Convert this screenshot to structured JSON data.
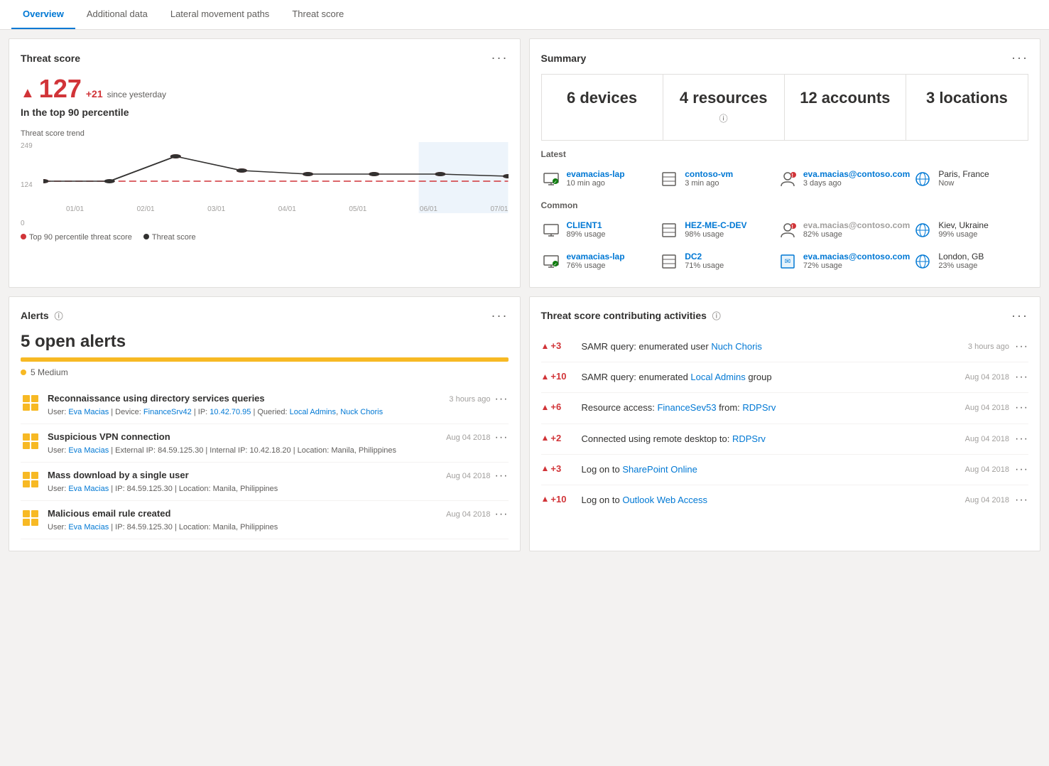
{
  "tabs": [
    {
      "label": "Overview",
      "active": true
    },
    {
      "label": "Additional data",
      "active": false
    },
    {
      "label": "Lateral movement paths",
      "active": false
    },
    {
      "label": "Threat score",
      "active": false
    }
  ],
  "threatScore": {
    "title": "Threat score",
    "score": "127",
    "delta": "+21",
    "delta_label": "since yesterday",
    "percentile_text": "In the top 90 percentile",
    "chart_label": "Threat score trend",
    "y_labels": [
      "249",
      "124",
      "0"
    ],
    "x_labels": [
      "01/01",
      "02/01",
      "03/01",
      "04/01",
      "05/01",
      "06/01",
      "07/01"
    ],
    "legend": [
      {
        "label": "Top 90 percentile threat score",
        "color": "#d13438"
      },
      {
        "label": "Threat score",
        "color": "#323130"
      }
    ]
  },
  "summary": {
    "title": "Summary",
    "stats": [
      {
        "value": "6 devices",
        "label": ""
      },
      {
        "value": "4 resources",
        "label": "",
        "has_info": true
      },
      {
        "value": "12 accounts",
        "label": ""
      },
      {
        "value": "3 locations",
        "label": ""
      }
    ],
    "latest_label": "Latest",
    "latest_items": [
      {
        "name": "evamacias-lap",
        "time": "10 min ago",
        "type": "device",
        "color": "blue"
      },
      {
        "name": "contoso-vm",
        "time": "3 min ago",
        "type": "server",
        "color": "blue"
      },
      {
        "name": "eva.macias@contoso.com",
        "time": "3 days ago",
        "type": "user",
        "color": "blue",
        "alert": true
      },
      {
        "name": "Paris, France",
        "time": "Now",
        "type": "globe",
        "color": "blue"
      }
    ],
    "common_label": "Common",
    "common_items": [
      {
        "name": "CLIENT1",
        "usage": "89% usage",
        "type": "device"
      },
      {
        "name": "HEZ-ME-C-DEV",
        "usage": "98% usage",
        "type": "server"
      },
      {
        "name": "eva.macias@contoso.com",
        "usage": "82% usage",
        "type": "user",
        "alert": true,
        "gray": true
      },
      {
        "name": "Kiev, Ukraine",
        "usage": "99% usage",
        "type": "globe"
      }
    ],
    "common2_items": [
      {
        "name": "evamacias-lap",
        "usage": "76% usage",
        "type": "device"
      },
      {
        "name": "DC2",
        "usage": "71% usage",
        "type": "server"
      },
      {
        "name": "eva.macias@contoso.com",
        "usage": "72% usage",
        "type": "user"
      },
      {
        "name": "London, GB",
        "usage": "23% usage",
        "type": "globe"
      }
    ]
  },
  "alerts": {
    "title": "Alerts",
    "count_text": "5 open alerts",
    "medium_text": "5 Medium",
    "items": [
      {
        "title": "Reconnaissance using directory services queries",
        "time": "3 hours ago",
        "detail": "User: Eva Macias | Device: FinanceSrv42 | IP: 10.42.70.95 | Queried: Local Admins, Nuck Choris"
      },
      {
        "title": "Suspicious VPN connection",
        "time": "Aug 04 2018",
        "detail": "User: Eva Macias | External IP: 84.59.125.30 | Internal IP: 10.42.18.20 | Location: Manila, Philippines"
      },
      {
        "title": "Mass download by a single user",
        "time": "Aug 04 2018",
        "detail": "User: Eva Macias | IP: 84.59.125.30 | Location: Manila, Philippines"
      },
      {
        "title": "Malicious email rule created",
        "time": "Aug 04 2018",
        "detail": "User: Eva Macias | IP: 84.59.125.30 | Location: Manila, Philippines"
      }
    ]
  },
  "threatActivities": {
    "title": "Threat score contributing activities",
    "items": [
      {
        "delta": "+3",
        "description": "SAMR query: enumerated user ",
        "link_text": "Nuch Choris",
        "suffix": "",
        "time": "3 hours ago"
      },
      {
        "delta": "+10",
        "description": "SAMR query: enumerated ",
        "link_text": "Local Admins",
        "suffix": " group",
        "time": "Aug 04 2018"
      },
      {
        "delta": "+6",
        "description": "Resource access: ",
        "link_text": "FinanceSev53",
        "suffix": " from: ",
        "link2_text": "RDPSrv",
        "time": "Aug 04 2018"
      },
      {
        "delta": "+2",
        "description": "Connected using remote desktop to: ",
        "link_text": "RDPSrv",
        "suffix": "",
        "time": "Aug 04 2018"
      },
      {
        "delta": "+3",
        "description": "Log on to ",
        "link_text": "SharePoint Online",
        "suffix": "",
        "time": "Aug 04 2018"
      },
      {
        "delta": "+10",
        "description": "Log on to ",
        "link_text": "Outlook Web Access",
        "suffix": "",
        "time": "Aug 04 2018"
      }
    ]
  }
}
